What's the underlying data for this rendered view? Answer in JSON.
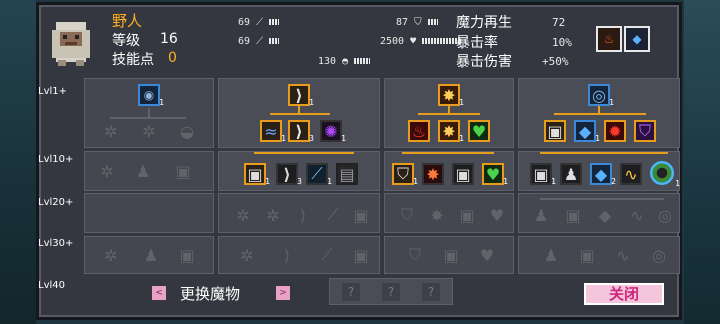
{
  "character": {
    "name": "野人",
    "level_label": "等级",
    "level_value": "16",
    "skill_points_label": "技能点",
    "skill_points_value": "0",
    "portrait_icon": "yeti-portrait-icon"
  },
  "stats": {
    "attack_1": "69",
    "attack_2": "69",
    "armor": "87",
    "health": "2500",
    "speed": "130"
  },
  "derived": {
    "mana_regen_label": "魔力再生",
    "mana_regen_value": "72",
    "crit_rate_label": "暴击率",
    "crit_rate_value": "10%",
    "crit_damage_label": "暴击伤害",
    "crit_damage_value": "+50%"
  },
  "level_rows": [
    "Lvl1+",
    "Lvl10+",
    "Lvl20+",
    "Lvl30+",
    "Lvl40"
  ],
  "skill_levels": {
    "b1_top": "1",
    "b2_top": "1",
    "b2_r2a": "1",
    "b2_r2b": "3",
    "b2_r2c": "1",
    "b2_r3a": "1",
    "b2_r3b": "3",
    "b2_r3c": "1",
    "b3_top": "1",
    "b3_r2b": "1",
    "b3_r3a": "1",
    "b3_r3d": "1",
    "b4_top": "1",
    "b4_r2b": "1",
    "b4_r3a": "1",
    "b4_r3c": "2",
    "b4_r3e": "1"
  },
  "unknown_slots": [
    "?",
    "?",
    "?"
  ],
  "buttons": {
    "change_monster": "更换魔物",
    "prev_arrow": "<",
    "next_arrow": ">",
    "close": "关闭"
  },
  "colors": {
    "panel": "#34373f",
    "orange_accent": "#ffb021",
    "unlocked_border": "#e89c1c",
    "selected_border": "#3a88d6",
    "close_text": "#d0257d"
  }
}
